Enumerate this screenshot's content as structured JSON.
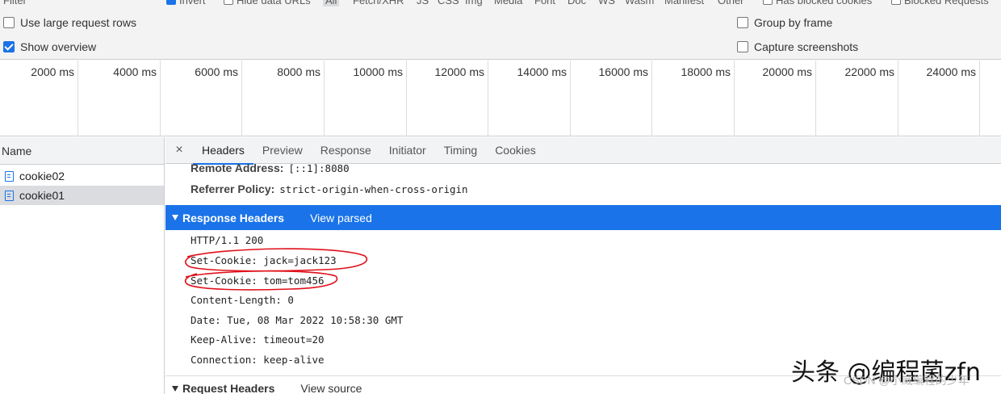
{
  "filter_strip": {
    "filter_label": "Filter",
    "invert_label": "Invert",
    "hide_data_urls_label": "Hide data URLs",
    "types": [
      "All",
      "Fetch/XHR",
      "JS",
      "CSS",
      "Img",
      "Media",
      "Font",
      "Doc",
      "WS",
      "Wasm",
      "Manifest",
      "Other"
    ],
    "has_blocked_cookies_label": "Has blocked cookies",
    "blocked_requests_label": "Blocked Requests"
  },
  "settings": {
    "large_rows": {
      "label": "Use large request rows",
      "checked": false
    },
    "show_overview": {
      "label": "Show overview",
      "checked": true
    },
    "group_by_frame": {
      "label": "Group by frame",
      "checked": false
    },
    "capture_screenshots": {
      "label": "Capture screenshots",
      "checked": false
    }
  },
  "overview": {
    "ticks": [
      "2000 ms",
      "4000 ms",
      "6000 ms",
      "8000 ms",
      "10000 ms",
      "12000 ms",
      "14000 ms",
      "16000 ms",
      "18000 ms",
      "20000 ms",
      "22000 ms",
      "24000 ms"
    ]
  },
  "name_panel": {
    "header": "Name",
    "requests": [
      {
        "name": "cookie02",
        "selected": false
      },
      {
        "name": "cookie01",
        "selected": true
      }
    ]
  },
  "details": {
    "close_glyph": "×",
    "tabs": [
      "Headers",
      "Preview",
      "Response",
      "Initiator",
      "Timing",
      "Cookies"
    ],
    "active_tab": "Headers",
    "general": [
      {
        "key": "Remote Address:",
        "value": "[::1]:8080"
      },
      {
        "key": "Referrer Policy:",
        "value": "strict-origin-when-cross-origin"
      }
    ],
    "response_headers": {
      "title": "Response Headers",
      "link": "View parsed",
      "lines": [
        "HTTP/1.1 200",
        "Set-Cookie: jack=jack123",
        "Set-Cookie: tom=tom456",
        "Content-Length: 0",
        "Date: Tue, 08 Mar 2022 10:58:30 GMT",
        "Keep-Alive: timeout=20",
        "Connection: keep-alive"
      ]
    },
    "request_headers": {
      "title": "Request Headers",
      "link": "View source"
    }
  },
  "watermark": {
    "main": "头条 @编程菌zfn",
    "sub": "CSDN @小威编程的少年"
  },
  "colors": {
    "accent": "#1a73e8",
    "annotation_red": "#e0101a"
  }
}
